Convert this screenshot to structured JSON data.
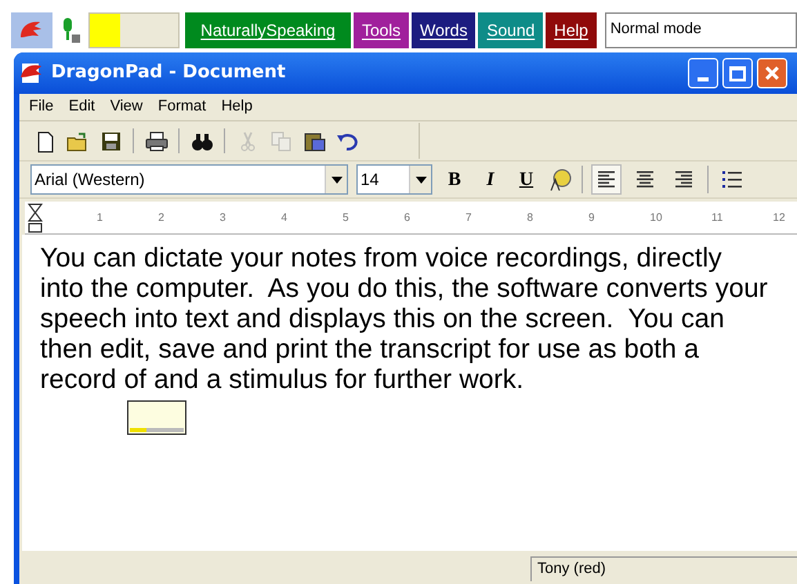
{
  "dragon_bar": {
    "mic_on": true,
    "volume": {
      "level": 0.35
    },
    "menus": [
      {
        "label": "NaturallySpeaking",
        "color": "#008a1e"
      },
      {
        "label": "Tools",
        "color": "#a0209c"
      },
      {
        "label": "Words",
        "color": "#1c1c80"
      },
      {
        "label": "Sound",
        "color": "#0e8c88"
      },
      {
        "label": "Help",
        "color": "#900a0a"
      }
    ],
    "mode": "Normal mode"
  },
  "window": {
    "title": "DragonPad - Document"
  },
  "menu_bar": [
    "File",
    "Edit",
    "View",
    "Format",
    "Help"
  ],
  "toolbar": [
    {
      "kind": "new",
      "disabled": false
    },
    {
      "kind": "open",
      "disabled": false
    },
    {
      "kind": "save",
      "disabled": false
    },
    {
      "kind": "sep"
    },
    {
      "kind": "print",
      "disabled": false
    },
    {
      "kind": "sep"
    },
    {
      "kind": "find",
      "disabled": false
    },
    {
      "kind": "sep"
    },
    {
      "kind": "cut",
      "disabled": true
    },
    {
      "kind": "copy",
      "disabled": true
    },
    {
      "kind": "paste",
      "disabled": false
    },
    {
      "kind": "undo",
      "disabled": false
    }
  ],
  "format_bar": {
    "font": "Arial (Western)",
    "size": "14",
    "styles": [
      {
        "label": "B",
        "kind": "bold"
      },
      {
        "label": "I",
        "kind": "italic"
      },
      {
        "label": "U",
        "kind": "underline"
      }
    ],
    "alignments": [
      {
        "kind": "left",
        "selected": true
      },
      {
        "kind": "center",
        "selected": false
      },
      {
        "kind": "right",
        "selected": false
      }
    ]
  },
  "ruler": [
    "1",
    "2",
    "3",
    "4",
    "5",
    "6",
    "7",
    "8",
    "9",
    "10",
    "11",
    "12"
  ],
  "document": {
    "text": "You can dictate your notes from voice recordings, directly into the computer.  As you do this, the software converts your speech into text and displays this on the screen.  You can then edit, save and print the transcript for use as both a record of and a stimulus for further work.",
    "recognition_box": {
      "level": 0.3
    }
  },
  "status_bar": {
    "user": "Tony (red)"
  }
}
